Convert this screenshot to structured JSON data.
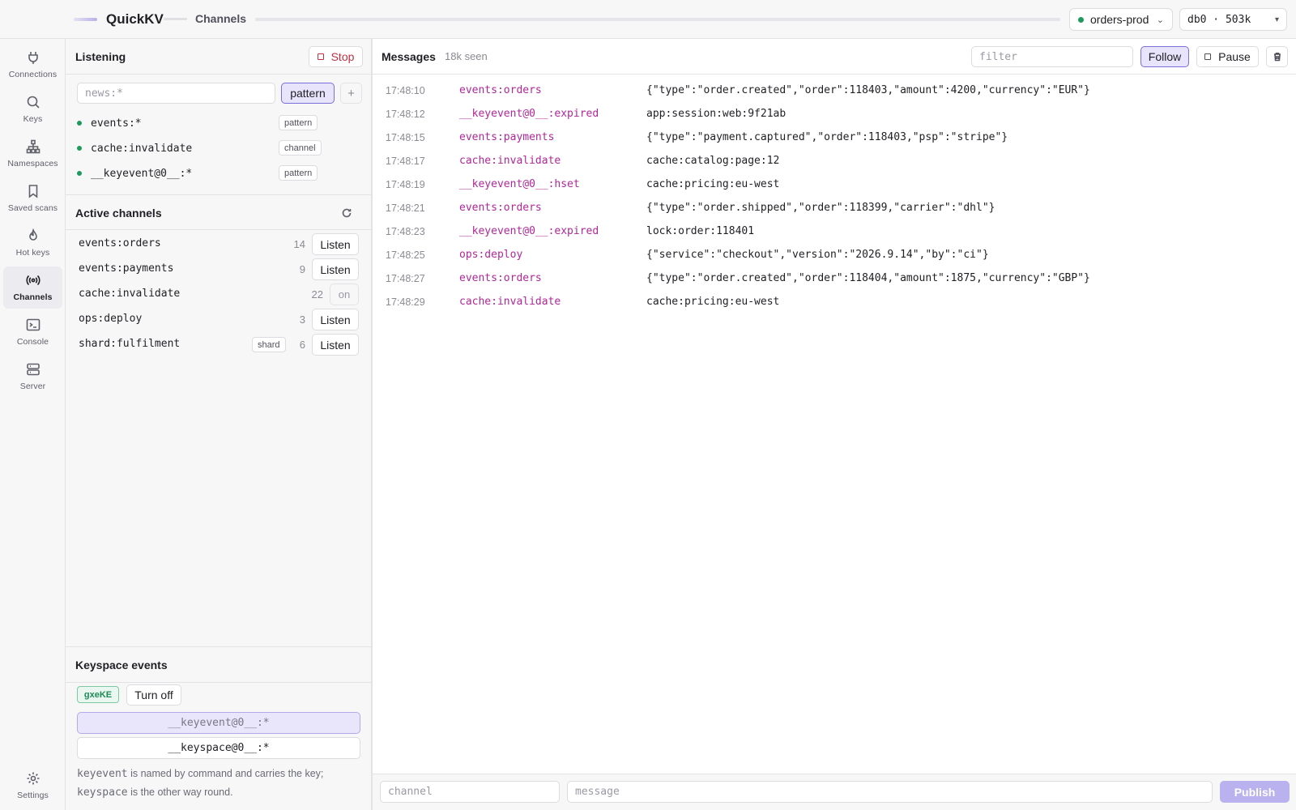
{
  "header": {
    "app_name": "QuickKV",
    "breadcrumb": "Channels",
    "connection": {
      "name": "orders-prod",
      "status_color": "#1e9b5c"
    },
    "database": "db0 · 503k"
  },
  "nav": {
    "items": [
      {
        "label": "Connections",
        "icon": "plug-icon"
      },
      {
        "label": "Keys",
        "icon": "search-icon"
      },
      {
        "label": "Namespaces",
        "icon": "tree-icon"
      },
      {
        "label": "Saved scans",
        "icon": "bookmark-icon"
      },
      {
        "label": "Hot keys",
        "icon": "flame-icon"
      },
      {
        "label": "Channels",
        "icon": "broadcast-icon",
        "active": true
      },
      {
        "label": "Console",
        "icon": "terminal-icon"
      },
      {
        "label": "Server",
        "icon": "server-icon"
      }
    ],
    "settings_label": "Settings"
  },
  "listening": {
    "title": "Listening",
    "stop_label": "Stop",
    "input_placeholder": "news:*",
    "mode_label": "pattern",
    "add_label": "+",
    "subscriptions": [
      {
        "name": "events:*",
        "kind": "pattern"
      },
      {
        "name": "cache:invalidate",
        "kind": "channel"
      },
      {
        "name": "__keyevent@0__:*",
        "kind": "pattern"
      }
    ]
  },
  "active_channels": {
    "title": "Active channels",
    "rows": [
      {
        "name": "events:orders",
        "count": "14",
        "action": "Listen"
      },
      {
        "name": "events:payments",
        "count": "9",
        "action": "Listen"
      },
      {
        "name": "cache:invalidate",
        "count": "22",
        "action": "on"
      },
      {
        "name": "ops:deploy",
        "count": "3",
        "action": "Listen"
      },
      {
        "name": "shard:fulfilment",
        "tag": "shard",
        "count": "6",
        "action": "Listen"
      }
    ]
  },
  "keyspace": {
    "title": "Keyspace events",
    "flags": "gxeKE",
    "turn_off_label": "Turn off",
    "keyevent_pattern": "__keyevent@0__:*",
    "keyspace_pattern": "__keyspace@0__:*",
    "note": {
      "keyevent_word": "keyevent",
      "keyevent_text": " is named by command and carries the key;",
      "keyspace_word": "keyspace",
      "keyspace_text": " is the other way round."
    }
  },
  "messages": {
    "title": "Messages",
    "seen": "18k seen",
    "filter_placeholder": "filter",
    "follow_label": "Follow",
    "pause_label": "Pause",
    "accent_color": "#b0279a",
    "rows": [
      {
        "time": "17:48:10",
        "channel": "events:orders",
        "payload": "{\"type\":\"order.created\",\"order\":118403,\"amount\":4200,\"currency\":\"EUR\"}"
      },
      {
        "time": "17:48:12",
        "channel": "__keyevent@0__:expired",
        "payload": "app:session:web:9f21ab"
      },
      {
        "time": "17:48:15",
        "channel": "events:payments",
        "payload": "{\"type\":\"payment.captured\",\"order\":118403,\"psp\":\"stripe\"}"
      },
      {
        "time": "17:48:17",
        "channel": "cache:invalidate",
        "payload": "cache:catalog:page:12"
      },
      {
        "time": "17:48:19",
        "channel": "__keyevent@0__:hset",
        "payload": "cache:pricing:eu-west"
      },
      {
        "time": "17:48:21",
        "channel": "events:orders",
        "payload": "{\"type\":\"order.shipped\",\"order\":118399,\"carrier\":\"dhl\"}"
      },
      {
        "time": "17:48:23",
        "channel": "__keyevent@0__:expired",
        "payload": "lock:order:118401"
      },
      {
        "time": "17:48:25",
        "channel": "ops:deploy",
        "payload": "{\"service\":\"checkout\",\"version\":\"2026.9.14\",\"by\":\"ci\"}"
      },
      {
        "time": "17:48:27",
        "channel": "events:orders",
        "payload": "{\"type\":\"order.created\",\"order\":118404,\"amount\":1875,\"currency\":\"GBP\"}"
      },
      {
        "time": "17:48:29",
        "channel": "cache:invalidate",
        "payload": "cache:pricing:eu-west"
      }
    ]
  },
  "publish": {
    "channel_placeholder": "channel",
    "message_placeholder": "message",
    "button_label": "Publish"
  }
}
